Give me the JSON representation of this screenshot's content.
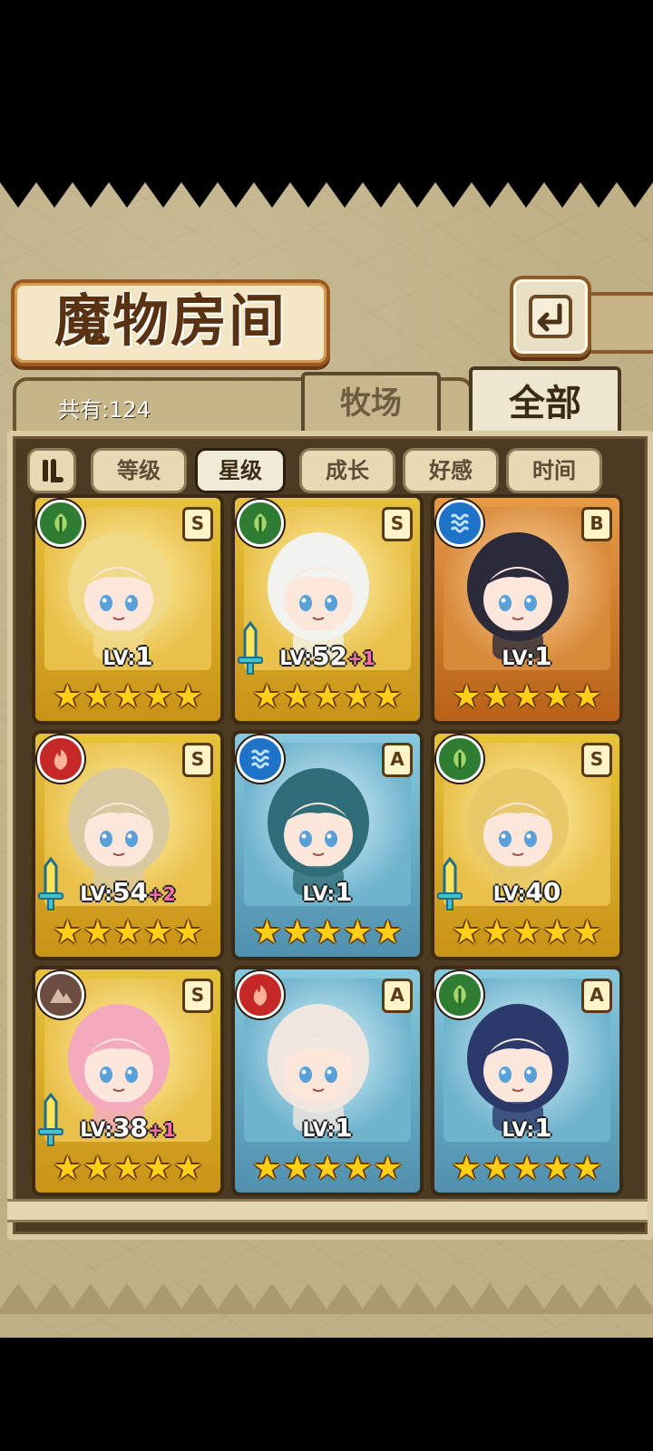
{
  "header": {
    "title": "魔物房间",
    "back_icon": "back-arrow-icon"
  },
  "summary": {
    "count_label": "共有:124"
  },
  "tabs": [
    {
      "label": "牧场",
      "active": false
    },
    {
      "label": "全部",
      "active": true
    }
  ],
  "filters": {
    "toggle_icon": "sort-toggle-icon",
    "items": [
      {
        "label": "等级",
        "active": false
      },
      {
        "label": "星级",
        "active": true
      },
      {
        "label": "成长",
        "active": false
      },
      {
        "label": "好感",
        "active": false
      },
      {
        "label": "时间",
        "active": false
      }
    ]
  },
  "monsters": [
    {
      "element": "grass",
      "element_icon": "leaf-icon",
      "rank": "S",
      "frame": "gold",
      "level_prefix": "LV:",
      "level": "1",
      "bonus": "",
      "sword": false,
      "stars": 5
    },
    {
      "element": "grass",
      "element_icon": "leaf-icon",
      "rank": "S",
      "frame": "gold",
      "level_prefix": "LV:",
      "level": "52",
      "bonus": "+1",
      "sword": true,
      "stars": 5
    },
    {
      "element": "water",
      "element_icon": "water-waves-icon",
      "rank": "B",
      "frame": "orange",
      "level_prefix": "LV:",
      "level": "1",
      "bonus": "",
      "sword": false,
      "stars": 5
    },
    {
      "element": "fire",
      "element_icon": "flame-icon",
      "rank": "S",
      "frame": "gold",
      "level_prefix": "LV:",
      "level": "54",
      "bonus": "+2",
      "sword": true,
      "stars": 5
    },
    {
      "element": "water",
      "element_icon": "water-waves-icon",
      "rank": "A",
      "frame": "blue",
      "level_prefix": "LV:",
      "level": "1",
      "bonus": "",
      "sword": false,
      "stars": 5
    },
    {
      "element": "grass",
      "element_icon": "leaf-icon",
      "rank": "S",
      "frame": "gold",
      "level_prefix": "LV:",
      "level": "40",
      "bonus": "",
      "sword": true,
      "stars": 5
    },
    {
      "element": "earth",
      "element_icon": "mountain-icon",
      "rank": "S",
      "frame": "gold",
      "level_prefix": "LV:",
      "level": "38",
      "bonus": "+1",
      "sword": true,
      "stars": 5
    },
    {
      "element": "fire",
      "element_icon": "flame-icon",
      "rank": "A",
      "frame": "blue",
      "level_prefix": "LV:",
      "level": "1",
      "bonus": "",
      "sword": false,
      "stars": 5
    },
    {
      "element": "grass",
      "element_icon": "leaf-icon",
      "rank": "A",
      "frame": "blue",
      "level_prefix": "LV:",
      "level": "1",
      "bonus": "",
      "sword": false,
      "stars": 5
    }
  ],
  "colors": {
    "panel_bg": "#bfb085",
    "gold_frame": "#e6c33a",
    "orange_frame": "#e89a45",
    "blue_frame": "#86c8de",
    "bonus_pink": "#ff6fa8",
    "star_yellow": "#ffcf1a"
  }
}
